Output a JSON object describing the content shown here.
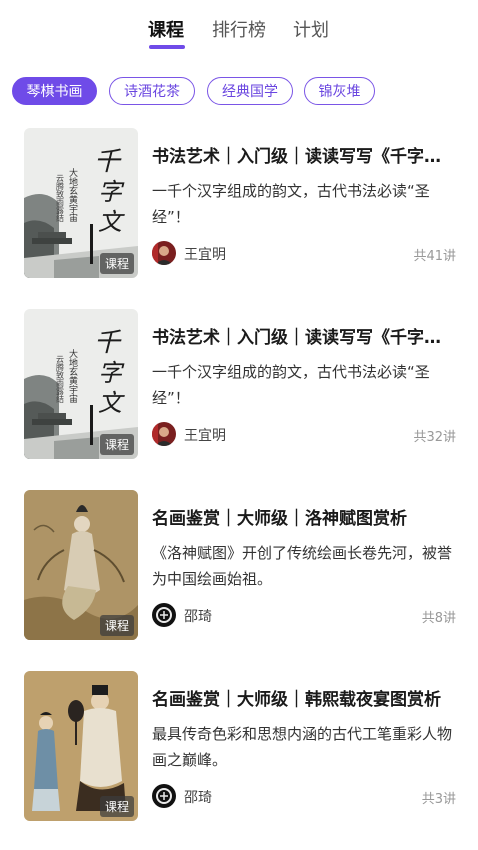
{
  "tabs": [
    {
      "label": "课程",
      "active": true
    },
    {
      "label": "排行榜",
      "active": false
    },
    {
      "label": "计划",
      "active": false
    }
  ],
  "categories": [
    {
      "label": "琴棋书画",
      "active": true
    },
    {
      "label": "诗酒花茶",
      "active": false
    },
    {
      "label": "经典国学",
      "active": false
    },
    {
      "label": "锦灰堆",
      "active": false
    }
  ],
  "courses": [
    {
      "title": "书法艺术｜入门级｜读读写写《千字文》",
      "description": "一千个汉字组成的韵文，古代书法必读“圣经”！",
      "author": "王宜明",
      "lessons": "共41讲",
      "badge": "课程",
      "thumb_icon": "calligraphy-thumbnail",
      "thumb_calligraphy": "千字文",
      "thumb_inscription": "大地玄黄宇宙 云腾致雨露结"
    },
    {
      "title": "书法艺术｜入门级｜读读写写《千字文》",
      "description": "一千个汉字组成的韵文，古代书法必读“圣经”！",
      "author": "王宜明",
      "lessons": "共32讲",
      "badge": "课程",
      "thumb_icon": "calligraphy-thumbnail",
      "thumb_calligraphy": "千字文",
      "thumb_inscription": "大地玄黄宇宙 云腾致雨露结"
    },
    {
      "title": "名画鉴赏｜大师级｜洛神赋图赏析",
      "description": "《洛神赋图》开创了传统绘画长卷先河，被誉为中国绘画始祖。",
      "author": "邵琦",
      "lessons": "共8讲",
      "badge": "课程",
      "thumb_icon": "painting-thumbnail"
    },
    {
      "title": "名画鉴赏｜大师级｜韩熙载夜宴图赏析",
      "description": "最具传奇色彩和思想内涵的古代工笔重彩人物画之巅峰。",
      "author": "邵琦",
      "lessons": "共3讲",
      "badge": "课程",
      "thumb_icon": "painting-thumbnail"
    }
  ],
  "colors": {
    "accent": "#6f4be8",
    "chip_text": "#6a46e0",
    "muted": "#999999"
  }
}
